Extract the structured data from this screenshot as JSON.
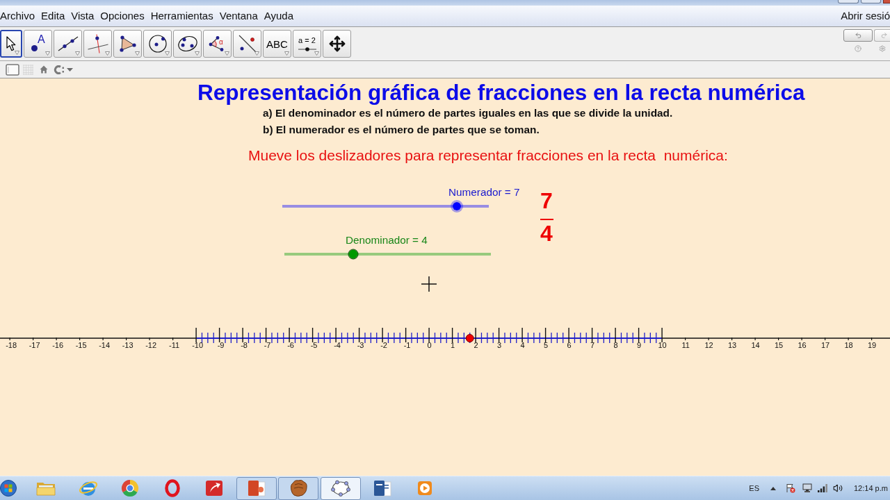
{
  "menu_bar": {
    "items": [
      "Archivo",
      "Edita",
      "Vista",
      "Opciones",
      "Herramientas",
      "Ventana",
      "Ayuda"
    ],
    "sign_in": "Abrir sesió"
  },
  "toolbar": {
    "tools": [
      {
        "kind": "move",
        "selected": true,
        "has_menu": true
      },
      {
        "kind": "point",
        "label": "A",
        "selected": false,
        "has_menu": true
      },
      {
        "kind": "line",
        "selected": false,
        "has_menu": true
      },
      {
        "kind": "perpendicular",
        "selected": false,
        "has_menu": true
      },
      {
        "kind": "polygon",
        "selected": false,
        "has_menu": true
      },
      {
        "kind": "circle",
        "selected": false,
        "has_menu": true
      },
      {
        "kind": "conic",
        "selected": false,
        "has_menu": true
      },
      {
        "kind": "angle",
        "label": "α",
        "selected": false,
        "has_menu": true
      },
      {
        "kind": "reflect",
        "selected": false,
        "has_menu": true
      },
      {
        "kind": "text",
        "label": "ABC",
        "selected": false,
        "has_menu": true
      },
      {
        "kind": "slider",
        "label": "a = 2",
        "selected": false,
        "has_menu": true
      },
      {
        "kind": "move_view",
        "selected": false,
        "has_menu": false
      }
    ]
  },
  "canvas": {
    "title": "Representación gráfica de fracciones en la recta numérica",
    "notes": [
      "a) El denominador es el número de partes iguales en las que se divide la unidad.",
      "b) El numerador es el número de partes que se toman."
    ],
    "instruction": "Mueve los deslizadores para representar fracciones en la recta  numérica:",
    "sliders": [
      {
        "label": "Numerador = 7",
        "color": "#0000ff",
        "level": 0.845,
        "selected": true
      },
      {
        "label": "Denominador = 4",
        "color": "#009900",
        "level": 0.333,
        "selected": false
      }
    ],
    "fraction": {
      "numerator": "7",
      "denominator": "4"
    },
    "number_line": {
      "labels": [
        {
          "text": "-18",
          "partitioned": false
        },
        {
          "text": "-17",
          "partitioned": false
        },
        {
          "text": "-16",
          "partitioned": false
        },
        {
          "text": "-15",
          "partitioned": false
        },
        {
          "text": "-14",
          "partitioned": false
        },
        {
          "text": "-13",
          "partitioned": false
        },
        {
          "text": "-12",
          "partitioned": false
        },
        {
          "text": "-11",
          "partitioned": false
        },
        {
          "text": "-10",
          "partitioned": true
        },
        {
          "text": "-9",
          "partitioned": true
        },
        {
          "text": "-8",
          "partitioned": true
        },
        {
          "text": "-7",
          "partitioned": true
        },
        {
          "text": "-6",
          "partitioned": true
        },
        {
          "text": "-5",
          "partitioned": true
        },
        {
          "text": "-4",
          "partitioned": true
        },
        {
          "text": "-3",
          "partitioned": true
        },
        {
          "text": "-2",
          "partitioned": true
        },
        {
          "text": "-1",
          "partitioned": true
        },
        {
          "text": "0",
          "partitioned": true
        },
        {
          "text": "1",
          "partitioned": true
        },
        {
          "text": "2",
          "partitioned": true
        },
        {
          "text": "3",
          "partitioned": true
        },
        {
          "text": "4",
          "partitioned": true
        },
        {
          "text": "5",
          "partitioned": true
        },
        {
          "text": "6",
          "partitioned": true
        },
        {
          "text": "7",
          "partitioned": true
        },
        {
          "text": "8",
          "partitioned": true
        },
        {
          "text": "9",
          "partitioned": true
        },
        {
          "text": "10",
          "partitioned": true
        },
        {
          "text": "11",
          "partitioned": false
        },
        {
          "text": "12",
          "partitioned": false
        },
        {
          "text": "13",
          "partitioned": false
        },
        {
          "text": "14",
          "partitioned": false
        },
        {
          "text": "15",
          "partitioned": false
        },
        {
          "text": "16",
          "partitioned": false
        },
        {
          "text": "17",
          "partitioned": false
        },
        {
          "text": "18",
          "partitioned": false
        },
        {
          "text": "19",
          "partitioned": false
        }
      ]
    }
  },
  "taskbar": {
    "apps": [
      {
        "kind": "folder",
        "open": false,
        "selected": false
      },
      {
        "kind": "e_browser",
        "open": false,
        "selected": false
      },
      {
        "kind": "round_browser",
        "open": false,
        "selected": false
      },
      {
        "kind": "o_browser",
        "open": false,
        "selected": false
      },
      {
        "kind": "arrow_app",
        "open": false,
        "selected": false
      },
      {
        "kind": "slides",
        "open": true,
        "selected": false
      },
      {
        "kind": "glove",
        "open": true,
        "selected": false
      },
      {
        "kind": "pentagon",
        "open": true,
        "selected": true
      },
      {
        "kind": "document",
        "open": false,
        "selected": false
      },
      {
        "kind": "player",
        "open": false,
        "selected": false
      }
    ],
    "language": "ES",
    "clock": "12:14 p.m"
  }
}
